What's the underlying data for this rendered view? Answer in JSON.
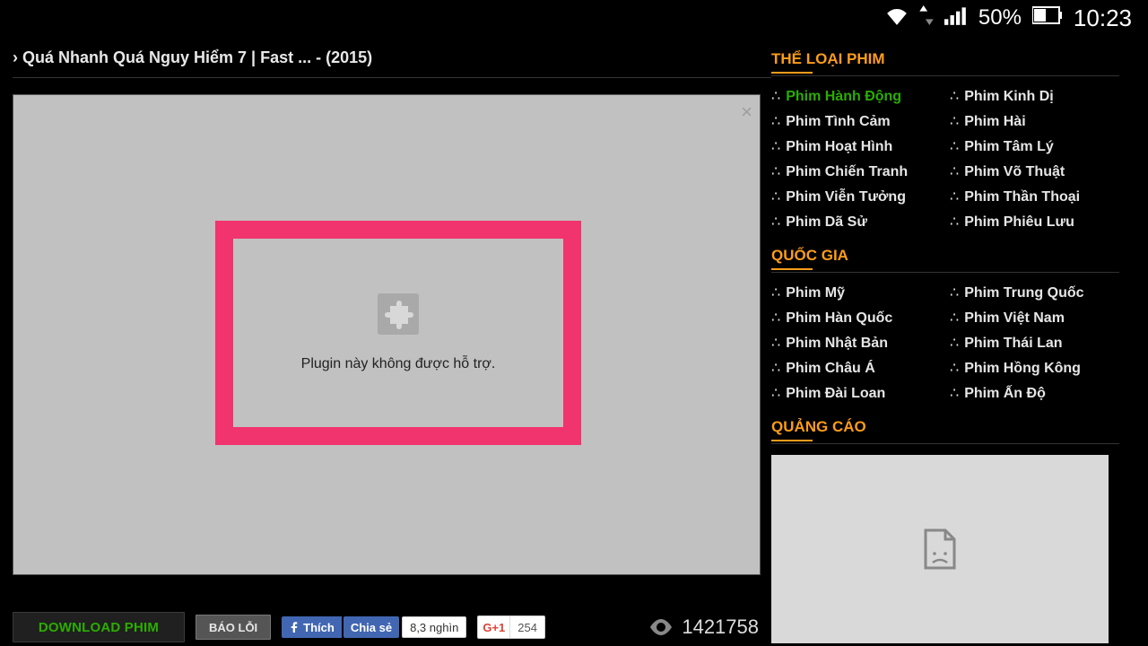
{
  "status": {
    "battery_pct": "50%",
    "clock": "10:23"
  },
  "breadcrumb": {
    "caret": "›",
    "title": "Quá Nhanh Quá Nguy Hiểm 7 | Fast ... - (2015)"
  },
  "player": {
    "plugin_msg": "Plugin này không được hỗ trợ."
  },
  "actions": {
    "download": "DOWNLOAD PHIM",
    "report": "BÁO LỖI",
    "fb_like": "Thích",
    "fb_share": "Chia sẻ",
    "fb_count": "8,3 nghìn",
    "gplus_badge": "G+1",
    "gplus_count": "254",
    "views": "1421758"
  },
  "sidebar": {
    "genres_title": "THỂ LOẠI PHIM",
    "countries_title": "QUỐC GIA",
    "ads_title": "QUẢNG CÁO",
    "genres": [
      "Phim Hành Động",
      "Phim Kinh Dị",
      "Phim Tình Cảm",
      "Phim Hài",
      "Phim Hoạt Hình",
      "Phim Tâm Lý",
      "Phim Chiến Tranh",
      "Phim Võ Thuật",
      "Phim Viễn Tưởng",
      "Phim Thần Thoại",
      "Phim Dã Sử",
      "Phim Phiêu Lưu"
    ],
    "countries": [
      "Phim Mỹ",
      "Phim Trung Quốc",
      "Phim Hàn Quốc",
      "Phim Việt Nam",
      "Phim Nhật Bản",
      "Phim Thái Lan",
      "Phim Châu Á",
      "Phim Hồng Kông",
      "Phim Đài Loan",
      "Phim Ấn Độ"
    ]
  }
}
